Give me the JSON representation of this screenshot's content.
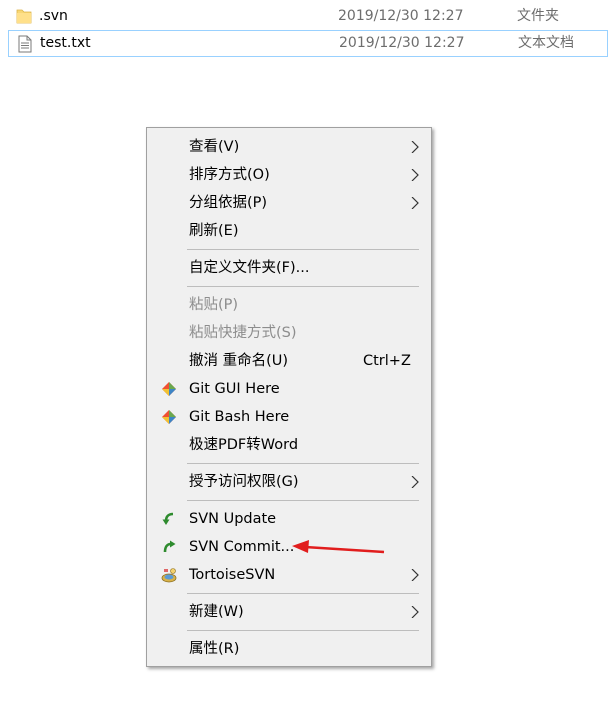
{
  "files": [
    {
      "name": ".svn",
      "date": "2019/12/30 12:27",
      "type": "文件夹",
      "icon": "folder-icon"
    },
    {
      "name": "test.txt",
      "date": "2019/12/30 12:27",
      "type": "文本文档",
      "icon": "text-file-icon"
    }
  ],
  "menu": {
    "view": "查看(V)",
    "sort": "排序方式(O)",
    "group": "分组依据(P)",
    "refresh": "刷新(E)",
    "customize": "自定义文件夹(F)...",
    "paste": "粘贴(P)",
    "paste_shortcut": "粘贴快捷方式(S)",
    "undo": "撤消 重命名(U)",
    "undo_shortcut": "Ctrl+Z",
    "git_gui": "Git GUI Here",
    "git_bash": "Git Bash Here",
    "pdf_word": "极速PDF转Word",
    "grant_access": "授予访问权限(G)",
    "svn_update": "SVN Update",
    "svn_commit": "SVN Commit...",
    "tortoise": "TortoiseSVN",
    "new": "新建(W)",
    "properties": "属性(R)"
  },
  "colors": {
    "menu_bg": "#f0f0f0",
    "disabled_text": "#8d8d8d",
    "selection_border": "#99d1ff",
    "annotation_arrow": "#e11d1d",
    "svn_green": "#2e8b2e"
  }
}
